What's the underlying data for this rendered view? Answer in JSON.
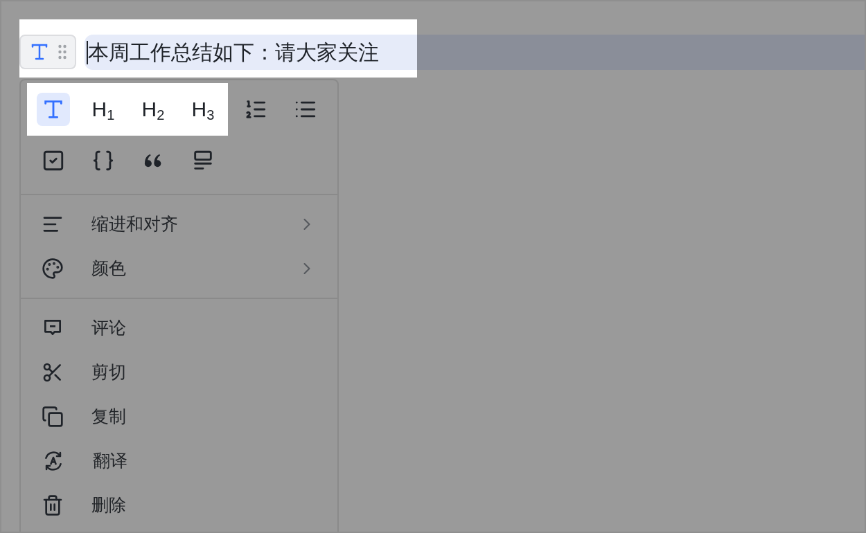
{
  "block_handle": {
    "kind": "text"
  },
  "selected_text": "本周工作总结如下：请大家关注",
  "formats": [
    {
      "kind": "text",
      "selected": true
    },
    {
      "kind": "heading",
      "label": "H$_{1}$",
      "selected": false
    },
    {
      "kind": "heading",
      "label": "H$_{2}$",
      "selected": false
    },
    {
      "kind": "heading",
      "label": "H$_{3}$",
      "selected": false
    },
    {
      "kind": "ordered_list",
      "selected": false
    },
    {
      "kind": "bullet_list",
      "selected": false
    },
    {
      "kind": "todo",
      "selected": false
    },
    {
      "kind": "code",
      "selected": false
    },
    {
      "kind": "quote",
      "selected": false
    },
    {
      "kind": "callout",
      "selected": false
    }
  ],
  "menu_groups": [
    [
      {
        "kind": "align",
        "label": "缩进和对齐",
        "submenu": true
      },
      {
        "kind": "palette",
        "label": "颜色",
        "submenu": true
      }
    ],
    [
      {
        "kind": "comment",
        "label": "评论",
        "submenu": false
      },
      {
        "kind": "cut",
        "label": "剪切",
        "submenu": false
      },
      {
        "kind": "copy",
        "label": "复制",
        "submenu": false
      },
      {
        "kind": "translate",
        "label": "翻译",
        "submenu": false
      },
      {
        "kind": "delete",
        "label": "删除",
        "submenu": false
      }
    ]
  ]
}
